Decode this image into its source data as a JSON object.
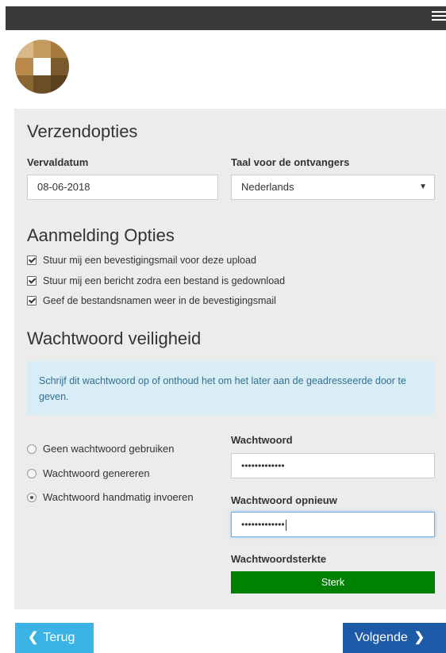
{
  "header": {
    "menu_icon": "hamburger-menu-icon"
  },
  "logo": {
    "icon": "logo-icon"
  },
  "verzend": {
    "title": "Verzendopties",
    "expiry_label": "Vervaldatum",
    "expiry_value": "08-06-2018",
    "language_label": "Taal voor de ontvangers",
    "language_value": "Nederlands"
  },
  "aanmelding": {
    "title": "Aanmelding Opties",
    "options": [
      {
        "label": "Stuur mij een bevestigingsmail voor deze upload",
        "checked": true
      },
      {
        "label": "Stuur mij een bericht zodra een bestand is gedownload",
        "checked": true
      },
      {
        "label": "Geef de bestandsnamen weer in de bevestigingsmail",
        "checked": true
      }
    ]
  },
  "wachtwoord": {
    "title": "Wachtwoord veiligheid",
    "info": "Schrijf dit wachtwoord op of onthoud het om het later aan de geadresseerde door te geven.",
    "radios": [
      {
        "label": "Geen wachtwoord gebruiken",
        "selected": false
      },
      {
        "label": "Wachtwoord genereren",
        "selected": false
      },
      {
        "label": "Wachtwoord handmatig invoeren",
        "selected": true
      }
    ],
    "password_label": "Wachtwoord",
    "password_value": "•••••••••••••",
    "repeat_label": "Wachtwoord opnieuw",
    "repeat_value": "•••••••••••••",
    "strength_label": "Wachtwoordsterkte",
    "strength_value": "Sterk",
    "strength_color": "#008000"
  },
  "footer": {
    "back_label": "Terug",
    "next_label": "Volgende",
    "back_color": "#3bb4e5",
    "next_color": "#1d5aa8"
  }
}
